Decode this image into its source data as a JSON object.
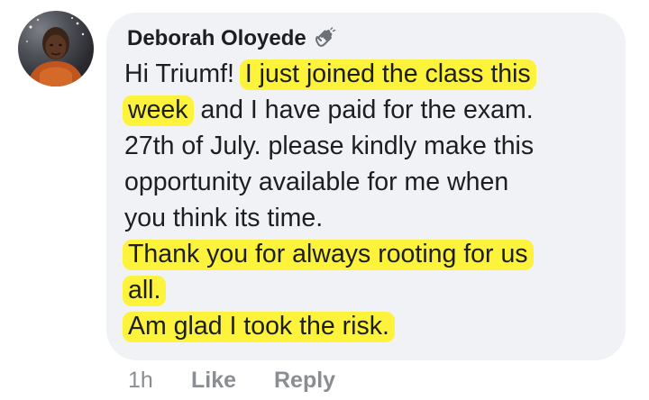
{
  "comment": {
    "author": "Deborah Oloyede",
    "badge_icon": "waving-hand-icon",
    "avatar_icon": "profile-photo",
    "text_lines": [
      [
        {
          "t": "Hi Triumf! ",
          "hl": false
        },
        {
          "t": "I just joined the class this",
          "hl": true
        }
      ],
      [
        {
          "t": "week",
          "hl": true
        },
        {
          "t": " and I have paid for the exam.",
          "hl": false
        }
      ],
      [
        {
          "t": "27th of July. please kindly make this",
          "hl": false
        }
      ],
      [
        {
          "t": "opportunity available for me when",
          "hl": false
        }
      ],
      [
        {
          "t": "you think its time.",
          "hl": false
        }
      ],
      [
        {
          "t": "Thank you for always rooting for us",
          "hl": true
        }
      ],
      [
        {
          "t": "all.",
          "hl": true
        }
      ],
      [
        {
          "t": "Am glad I took the risk.",
          "hl": true
        }
      ]
    ],
    "highlight_color": "#fdf33b",
    "bubble_color": "#f0f2f5"
  },
  "actions": {
    "timestamp": "1h",
    "like_label": "Like",
    "reply_label": "Reply"
  }
}
